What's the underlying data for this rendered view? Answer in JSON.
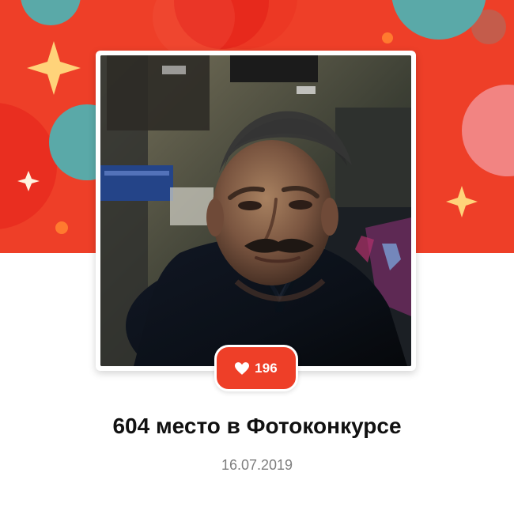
{
  "card": {
    "likes": "196",
    "title": "604 место в Фотоконкурсе",
    "date": "16.07.2019"
  },
  "icons": {
    "like": "heart-icon",
    "decor": [
      "sparkle-icon",
      "circle-decoration"
    ]
  },
  "colors": {
    "brand_red": "#ee3f28",
    "accent_orange": "#ff7a2f",
    "accent_teal": "#5aa9a8",
    "accent_pink": "#f28c8c",
    "sparkle_yellow": "#ffd37a",
    "text_dark": "#111111",
    "text_muted": "#7e7e7e"
  }
}
